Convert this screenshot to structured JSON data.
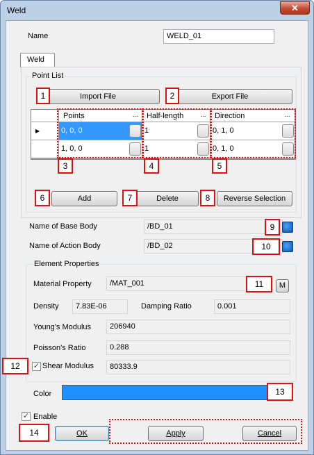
{
  "window": {
    "title": "Weld",
    "close_label": "✕"
  },
  "name": {
    "label": "Name",
    "value": "WELD_01"
  },
  "tab": {
    "label": "Weld"
  },
  "point_list": {
    "title": "Point List",
    "import_label": "Import File",
    "export_label": "Export File",
    "columns": [
      "Points",
      "Half-length",
      "Direction"
    ],
    "rows": [
      {
        "points": "0, 0, 0",
        "half_length": "1",
        "direction": "0, 1, 0"
      },
      {
        "points": "1, 0, 0",
        "half_length": "1",
        "direction": "0, 1, 0"
      }
    ],
    "ellipsis": "...",
    "add_label": "Add",
    "delete_label": "Delete",
    "reverse_label": "Reverse Selection"
  },
  "base_body": {
    "label": "Name of Base Body",
    "value": "/BD_01"
  },
  "action_body": {
    "label": "Name of Action Body",
    "value": "/BD_02"
  },
  "element_properties": {
    "title": "Element Properties",
    "material_label": "Material Property",
    "material_value": "/MAT_001",
    "material_btn": "M",
    "density_label": "Density",
    "density_value": "7.83E-06",
    "damping_label": "Damping Ratio",
    "damping_value": "0.001",
    "youngs_label": "Young's Modulus",
    "youngs_value": "206940",
    "poisson_label": "Poisson's Ratio",
    "poisson_value": "0.288",
    "shear_label": "Shear Modulus",
    "shear_value": "80333.9",
    "shear_checked": true
  },
  "color": {
    "label": "Color",
    "value": "#1e90ff"
  },
  "enable": {
    "label": "Enable",
    "checked": true
  },
  "footer": {
    "ok_label": "OK",
    "apply_label": "Apply",
    "cancel_label": "Cancel"
  },
  "callouts": [
    "1",
    "2",
    "3",
    "4",
    "5",
    "6",
    "7",
    "8",
    "9",
    "10",
    "11",
    "12",
    "13",
    "14"
  ]
}
